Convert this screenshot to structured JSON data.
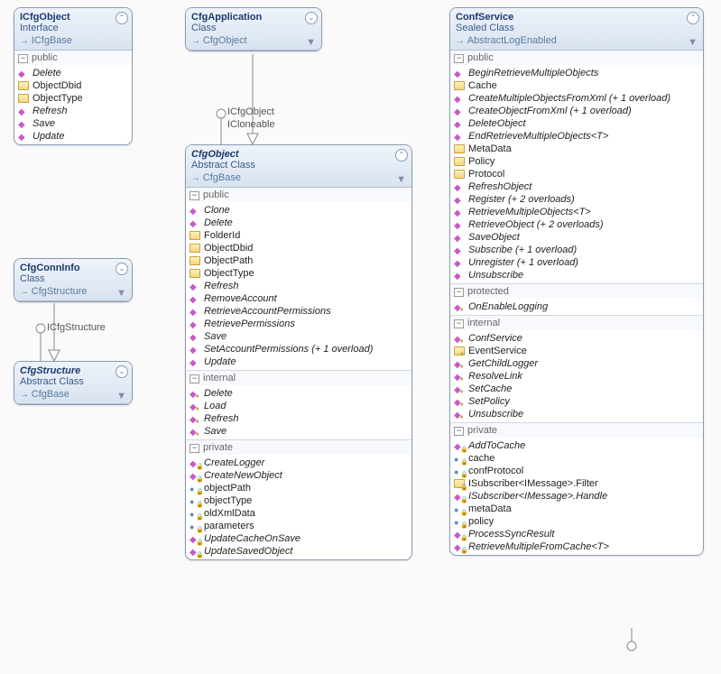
{
  "iface_labels": {
    "icfgobj": "ICfgObject",
    "icloneable": "ICloneable",
    "icfgstruct": "ICfgStructure"
  },
  "boxes": {
    "icfgobject": {
      "name": "ICfgObject",
      "kind": "Interface",
      "base": "ICfgBase",
      "sections": [
        {
          "label": "public",
          "members": [
            {
              "t": "method",
              "n": "Delete"
            },
            {
              "t": "prop",
              "n": "ObjectDbid"
            },
            {
              "t": "prop",
              "n": "ObjectType"
            },
            {
              "t": "method",
              "n": "Refresh"
            },
            {
              "t": "method",
              "n": "Save"
            },
            {
              "t": "method",
              "n": "Update"
            }
          ]
        }
      ]
    },
    "cfgapp": {
      "name": "CfgApplication",
      "kind": "Class",
      "base": "CfgObject",
      "sections": []
    },
    "cfgconninfo": {
      "name": "CfgConnInfo",
      "kind": "Class",
      "base": "CfgStructure",
      "sections": []
    },
    "cfgstructure": {
      "name": "CfgStructure",
      "kind": "Abstract Class",
      "base": "CfgBase",
      "sections": []
    },
    "cfgobject": {
      "name": "CfgObject",
      "kind": "Abstract Class",
      "base": "CfgBase",
      "sections": [
        {
          "label": "public",
          "members": [
            {
              "t": "method",
              "n": "Clone"
            },
            {
              "t": "method",
              "n": "Delete"
            },
            {
              "t": "prop",
              "n": "FolderId"
            },
            {
              "t": "prop",
              "n": "ObjectDbid"
            },
            {
              "t": "prop",
              "n": "ObjectPath"
            },
            {
              "t": "prop",
              "n": "ObjectType"
            },
            {
              "t": "method",
              "n": "Refresh"
            },
            {
              "t": "method",
              "n": "RemoveAccount"
            },
            {
              "t": "method",
              "n": "RetrieveAccountPermissions"
            },
            {
              "t": "method",
              "n": "RetrievePermissions"
            },
            {
              "t": "method",
              "n": "Save"
            },
            {
              "t": "method",
              "n": "SetAccountPermissions (+ 1 overload)"
            },
            {
              "t": "method",
              "n": "Update"
            }
          ]
        },
        {
          "label": "internal",
          "members": [
            {
              "t": "method",
              "n": "Delete"
            },
            {
              "t": "method",
              "n": "Load"
            },
            {
              "t": "method",
              "n": "Refresh"
            },
            {
              "t": "method",
              "n": "Save"
            }
          ]
        },
        {
          "label": "private",
          "members": [
            {
              "t": "method",
              "n": "CreateLogger"
            },
            {
              "t": "method",
              "n": "CreateNewObject"
            },
            {
              "t": "field",
              "n": "objectPath"
            },
            {
              "t": "field",
              "n": "objectType"
            },
            {
              "t": "field",
              "n": "oldXmlData"
            },
            {
              "t": "field",
              "n": "parameters"
            },
            {
              "t": "method",
              "n": "UpdateCacheOnSave"
            },
            {
              "t": "method",
              "n": "UpdateSavedObject"
            }
          ]
        }
      ]
    },
    "confservice": {
      "name": "ConfService",
      "kind": "Sealed Class",
      "base": "AbstractLogEnabled",
      "sections": [
        {
          "label": "public",
          "members": [
            {
              "t": "method",
              "n": "BeginRetrieveMultipleObjects"
            },
            {
              "t": "prop",
              "n": "Cache"
            },
            {
              "t": "method",
              "n": "CreateMultipleObjectsFromXml (+ 1 overload)"
            },
            {
              "t": "method",
              "n": "CreateObjectFromXml (+ 1 overload)"
            },
            {
              "t": "method",
              "n": "DeleteObject"
            },
            {
              "t": "method",
              "n": "EndRetrieveMultipleObjects<T>"
            },
            {
              "t": "prop",
              "n": "MetaData"
            },
            {
              "t": "prop",
              "n": "Policy"
            },
            {
              "t": "prop",
              "n": "Protocol"
            },
            {
              "t": "method",
              "n": "RefreshObject"
            },
            {
              "t": "method",
              "n": "Register (+ 2 overloads)"
            },
            {
              "t": "method",
              "n": "RetrieveMultipleObjects<T>"
            },
            {
              "t": "method",
              "n": "RetrieveObject (+ 2 overloads)"
            },
            {
              "t": "method",
              "n": "SaveObject"
            },
            {
              "t": "method",
              "n": "Subscribe (+ 1 overload)"
            },
            {
              "t": "method",
              "n": "Unregister (+ 1 overload)"
            },
            {
              "t": "method",
              "n": "Unsubscribe"
            }
          ]
        },
        {
          "label": "protected",
          "members": [
            {
              "t": "method",
              "n": "OnEnableLogging"
            }
          ]
        },
        {
          "label": "internal",
          "members": [
            {
              "t": "method",
              "n": "ConfService"
            },
            {
              "t": "prop",
              "n": "EventService"
            },
            {
              "t": "method",
              "n": "GetChildLogger"
            },
            {
              "t": "method",
              "n": "ResolveLink"
            },
            {
              "t": "method",
              "n": "SetCache"
            },
            {
              "t": "method",
              "n": "SetPolicy"
            },
            {
              "t": "method",
              "n": "Unsubscribe"
            }
          ]
        },
        {
          "label": "private",
          "members": [
            {
              "t": "method",
              "n": "AddToCache"
            },
            {
              "t": "field",
              "n": "cache"
            },
            {
              "t": "field",
              "n": "confProtocol"
            },
            {
              "t": "prop",
              "n": "ISubscriber<IMessage>.Filter"
            },
            {
              "t": "method",
              "n": "ISubscriber<IMessage>.Handle"
            },
            {
              "t": "field",
              "n": "metaData"
            },
            {
              "t": "field",
              "n": "policy"
            },
            {
              "t": "method",
              "n": "ProcessSyncResult"
            },
            {
              "t": "method",
              "n": "RetrieveMultipleFromCache<T>"
            }
          ]
        }
      ]
    }
  }
}
